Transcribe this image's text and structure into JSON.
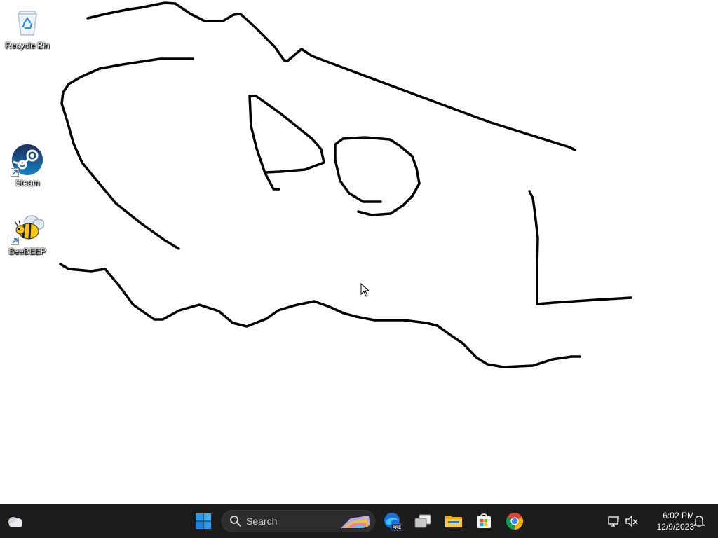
{
  "desktop": {
    "icons": [
      {
        "label": "Recycle Bin",
        "icon": "recycle-bin-icon"
      },
      {
        "label": "Steam",
        "icon": "steam-icon"
      },
      {
        "label": "BeeBEEP",
        "icon": "beebeep-icon"
      }
    ]
  },
  "taskbar": {
    "search": {
      "label": "Search"
    },
    "pinned": [
      {
        "name": "widgets",
        "icon": "weather-icon"
      },
      {
        "name": "start",
        "icon": "windows-start-icon"
      },
      {
        "name": "edge-preview",
        "icon": "edge-pre-icon",
        "badge": "PRE"
      },
      {
        "name": "task-view",
        "icon": "task-view-icon"
      },
      {
        "name": "file-explorer",
        "icon": "folder-icon"
      },
      {
        "name": "microsoft-store",
        "icon": "store-icon"
      },
      {
        "name": "chrome",
        "icon": "chrome-icon"
      }
    ],
    "clock": {
      "time": "6:02 PM",
      "date": "12/9/2023"
    }
  },
  "colors": {
    "taskbar_bg": "#1c1c1c",
    "desktop_bg": "#ffffff",
    "ink": "#000000"
  }
}
